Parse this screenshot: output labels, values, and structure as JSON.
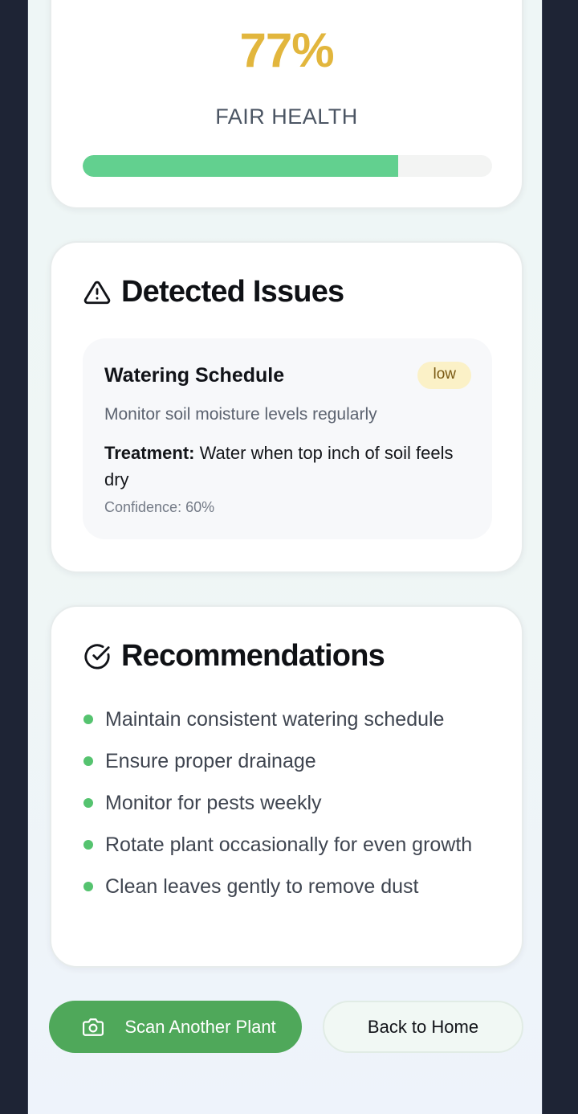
{
  "health": {
    "percent": "77%",
    "status_label": "FAIR HEALTH",
    "progress_fraction": 0.77,
    "score_color": "#e2b63d",
    "bar_color": "#62d08f"
  },
  "issues": {
    "title": "Detected Issues",
    "icon": "warning-triangle-icon",
    "items": [
      {
        "name": "Watering Schedule",
        "severity": "low",
        "description": "Monitor soil moisture levels regularly",
        "treatment_label": "Treatment:",
        "treatment": "Water when top inch of soil feels dry",
        "confidence": "Confidence: 60%"
      }
    ]
  },
  "recommendations": {
    "title": "Recommendations",
    "icon": "check-circle-icon",
    "items": [
      "Maintain consistent watering schedule",
      "Ensure proper drainage",
      "Monitor for pests weekly",
      "Rotate plant occasionally for even growth",
      "Clean leaves gently to remove dust"
    ],
    "bullet_color": "#55c36f"
  },
  "actions": {
    "scan_label": "Scan Another Plant",
    "scan_icon": "camera-icon",
    "home_label": "Back to Home",
    "accent": "#4fa85a"
  }
}
